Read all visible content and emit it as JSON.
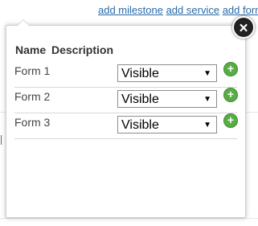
{
  "page": {
    "links": [
      "add milestone",
      "add service",
      "add form"
    ]
  },
  "popover": {
    "close_icon": "×",
    "headers": {
      "name": "Name",
      "description": "Description"
    },
    "rows": [
      {
        "name": "Form 1",
        "visibility": "Visible"
      },
      {
        "name": "Form 2",
        "visibility": "Visible"
      },
      {
        "name": "Form 3",
        "visibility": "Visible"
      }
    ],
    "caret_icon": "▼",
    "add_icon": "+"
  }
}
